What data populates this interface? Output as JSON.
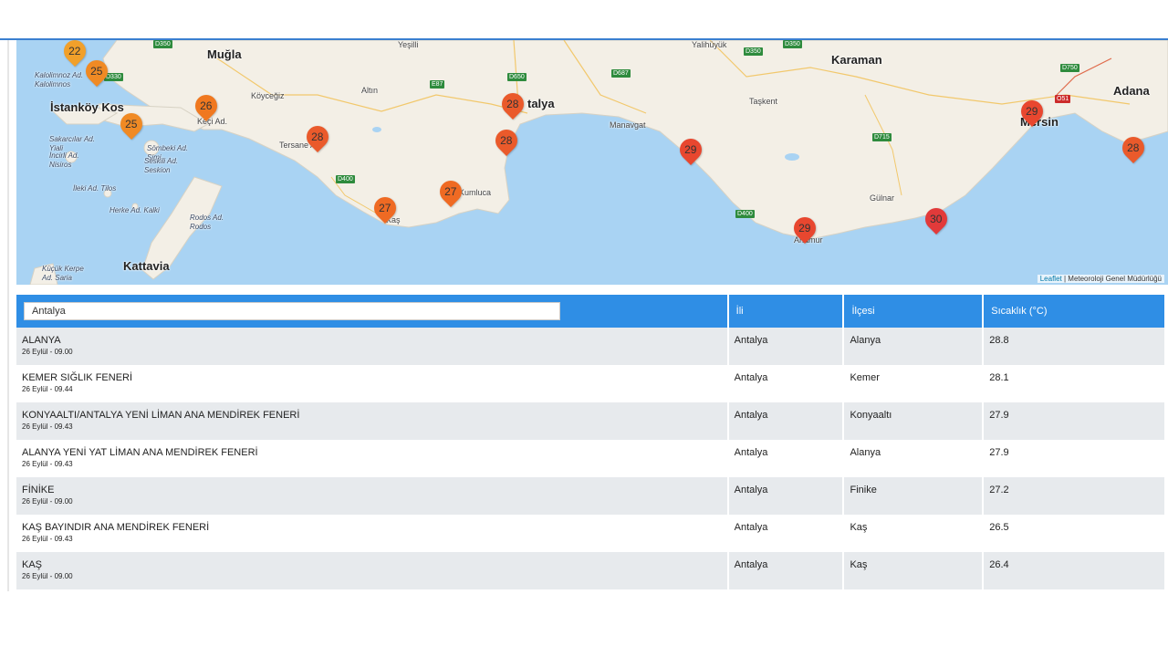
{
  "map": {
    "places": [
      {
        "name": "Muğla",
        "style": "bold"
      },
      {
        "name": "Karaman",
        "style": "bold"
      },
      {
        "name": "Adana",
        "style": "bold"
      },
      {
        "name": "Mersin",
        "style": "bold"
      },
      {
        "name": "talya",
        "style": "bold"
      },
      {
        "name": "İstanköy Kos",
        "style": "bold"
      },
      {
        "name": "Kattavia",
        "style": "bold"
      },
      {
        "name": "Köyceğiz",
        "style": "small"
      },
      {
        "name": "Altın",
        "style": "small"
      },
      {
        "name": "Manavgat",
        "style": "small"
      },
      {
        "name": "Taşkent",
        "style": "small"
      },
      {
        "name": "Gülnar",
        "style": "small"
      },
      {
        "name": "Anamur",
        "style": "small"
      },
      {
        "name": "Kumluca",
        "style": "small"
      },
      {
        "name": "Kaş",
        "style": "small"
      },
      {
        "name": "Keçi Ad.",
        "style": "small"
      },
      {
        "name": "Tersane Ad.",
        "style": "small"
      },
      {
        "name": "Kalolimnoz Ad. Kalolimnos",
        "style": "italic"
      },
      {
        "name": "Sakarcılar Ad. Yiali",
        "style": "italic"
      },
      {
        "name": "İncirli Ad. Nisiros",
        "style": "italic"
      },
      {
        "name": "Sömbeki Ad. Simi",
        "style": "italic"
      },
      {
        "name": "Seskili Ad. Seskion",
        "style": "italic"
      },
      {
        "name": "İleki Ad. Tilos",
        "style": "italic"
      },
      {
        "name": "Herke Ad. Kalki",
        "style": "italic"
      },
      {
        "name": "Rodos Ad. Rodos",
        "style": "italic"
      },
      {
        "name": "Küçük Kerpe Ad. Saria",
        "style": "italic"
      },
      {
        "name": "Yalihüyük",
        "style": "small"
      },
      {
        "name": "Yeşilli",
        "style": "small"
      }
    ],
    "roads": [
      "D330",
      "D350",
      "D400",
      "E87",
      "D650",
      "D687",
      "D350",
      "D350",
      "D400",
      "D715",
      "D750",
      "O51"
    ],
    "markers": [
      {
        "value": "22",
        "color": "#f1a02a"
      },
      {
        "value": "25",
        "color": "#f08a24"
      },
      {
        "value": "25",
        "color": "#f08a24"
      },
      {
        "value": "26",
        "color": "#f0781f"
      },
      {
        "value": "28",
        "color": "#ea5a2b"
      },
      {
        "value": "27",
        "color": "#ef6a23"
      },
      {
        "value": "27",
        "color": "#ef6a23"
      },
      {
        "value": "28",
        "color": "#ea5a2b"
      },
      {
        "value": "28",
        "color": "#ea5a2b"
      },
      {
        "value": "29",
        "color": "#e8472f"
      },
      {
        "value": "29",
        "color": "#e8472f"
      },
      {
        "value": "30",
        "color": "#e23a3a"
      },
      {
        "value": "29",
        "color": "#e8472f"
      },
      {
        "value": "28",
        "color": "#ea5a2b"
      }
    ],
    "attribution": {
      "link": "Leaflet",
      "text": " | Meteoroloji Genel Müdürlüğü"
    }
  },
  "table": {
    "search_value": "Antalya",
    "headers": {
      "il": "İli",
      "ilce": "İlçesi",
      "sicaklik": "Sıcaklık (°C)"
    },
    "rows": [
      {
        "name": "ALANYA",
        "time": "26 Eylül - 09.00",
        "il": "Antalya",
        "ilce": "Alanya",
        "temp": "28.8"
      },
      {
        "name": "KEMER SIĞLIK FENERİ",
        "time": "26 Eylül - 09.44",
        "il": "Antalya",
        "ilce": "Kemer",
        "temp": "28.1"
      },
      {
        "name": "KONYAALTI/ANTALYA YENİ LİMAN ANA MENDİREK FENERİ",
        "time": "26 Eylül - 09.43",
        "il": "Antalya",
        "ilce": "Konyaaltı",
        "temp": "27.9"
      },
      {
        "name": "ALANYA YENİ YAT LİMAN ANA MENDİREK FENERİ",
        "time": "26 Eylül - 09.43",
        "il": "Antalya",
        "ilce": "Alanya",
        "temp": "27.9"
      },
      {
        "name": "FİNİKE",
        "time": "26 Eylül - 09.00",
        "il": "Antalya",
        "ilce": "Finike",
        "temp": "27.2"
      },
      {
        "name": "KAŞ BAYINDIR ANA MENDİREK FENERİ",
        "time": "26 Eylül - 09.43",
        "il": "Antalya",
        "ilce": "Kaş",
        "temp": "26.5"
      },
      {
        "name": "KAŞ",
        "time": "26 Eylül - 09.00",
        "il": "Antalya",
        "ilce": "Kaş",
        "temp": "26.4"
      }
    ]
  }
}
